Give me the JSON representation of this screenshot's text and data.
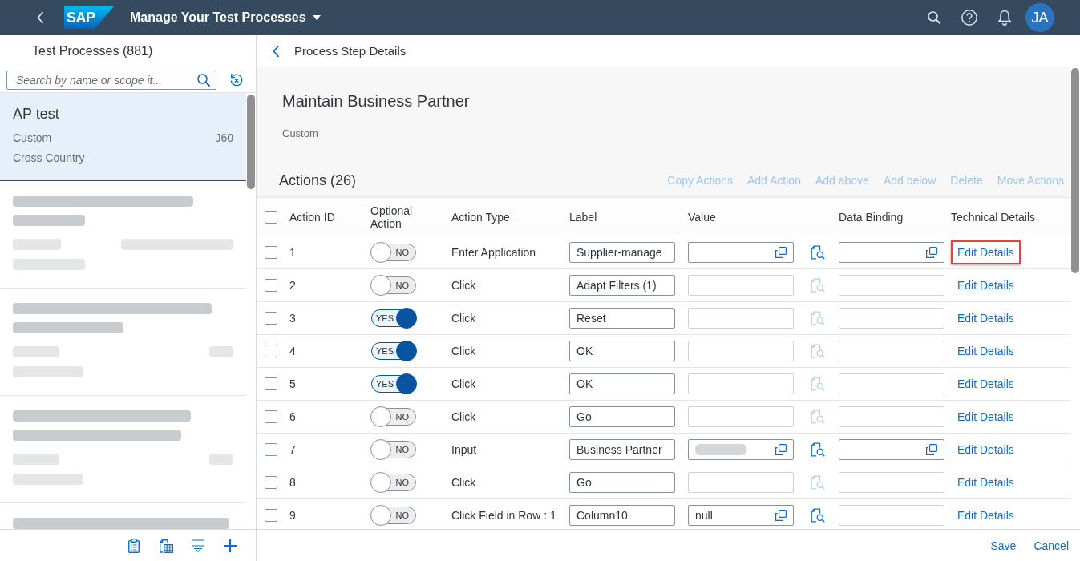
{
  "shell": {
    "logo": "SAP",
    "title": "Manage Your Test Processes",
    "avatar": "JA"
  },
  "master": {
    "title": "Test Processes (881)",
    "search": {
      "placeholder": "Search by name or scope it..."
    },
    "items": [
      {
        "kind": "process",
        "selected": true,
        "title": "AP test",
        "type": "Custom",
        "system": "J60",
        "scope": "Cross Country"
      },
      {
        "kind": "blurred",
        "selected": false
      },
      {
        "kind": "blurred",
        "selected": false
      },
      {
        "kind": "blurred",
        "selected": false
      },
      {
        "kind": "blurred",
        "selected": false
      }
    ]
  },
  "detail": {
    "nav_title": "Process Step Details",
    "title": "Maintain Business Partner",
    "subtitle": "Custom",
    "actions_title": "Actions (26)",
    "toolbar": [
      {
        "label": "Copy Actions",
        "disabled": true
      },
      {
        "label": "Add Action",
        "disabled": true
      },
      {
        "label": "Add above",
        "disabled": true
      },
      {
        "label": "Add below",
        "disabled": true
      },
      {
        "label": "Delete",
        "disabled": true
      },
      {
        "label": "Move Actions",
        "disabled": true
      }
    ],
    "table": {
      "select_all": {
        "checked": false
      },
      "columns": [
        "Action ID",
        "Optional Action",
        "Action Type",
        "Label",
        "Value",
        "Data Binding",
        "Technical Details"
      ],
      "rows": [
        {
          "selected": false,
          "action_id": "1",
          "optional": {
            "on": false,
            "text": "NO"
          },
          "action_type": "Enter Application",
          "label": "Supplier-manage",
          "value": {
            "enabled": true,
            "redacted": false
          },
          "data_binding": {
            "enabled": true
          },
          "details": {
            "text": "Edit Details",
            "highlighted": true
          }
        },
        {
          "selected": false,
          "action_id": "2",
          "optional": {
            "on": false,
            "text": "NO"
          },
          "action_type": "Click",
          "label": "Adapt Filters (1)",
          "value": {
            "enabled": false,
            "redacted": false
          },
          "data_binding": {
            "enabled": false
          },
          "details": {
            "text": "Edit Details",
            "highlighted": false
          }
        },
        {
          "selected": false,
          "action_id": "3",
          "optional": {
            "on": true,
            "text": "YES"
          },
          "action_type": "Click",
          "label": "Reset",
          "value": {
            "enabled": false,
            "redacted": false
          },
          "data_binding": {
            "enabled": false
          },
          "details": {
            "text": "Edit Details",
            "highlighted": false
          }
        },
        {
          "selected": false,
          "action_id": "4",
          "optional": {
            "on": true,
            "text": "YES"
          },
          "action_type": "Click",
          "label": "OK",
          "value": {
            "enabled": false,
            "redacted": false
          },
          "data_binding": {
            "enabled": false
          },
          "details": {
            "text": "Edit Details",
            "highlighted": false
          }
        },
        {
          "selected": false,
          "action_id": "5",
          "optional": {
            "on": true,
            "text": "YES"
          },
          "action_type": "Click",
          "label": "OK",
          "value": {
            "enabled": false,
            "redacted": false
          },
          "data_binding": {
            "enabled": false
          },
          "details": {
            "text": "Edit Details",
            "highlighted": false
          }
        },
        {
          "selected": false,
          "action_id": "6",
          "optional": {
            "on": false,
            "text": "NO"
          },
          "action_type": "Click",
          "label": "Go",
          "value": {
            "enabled": false,
            "redacted": false
          },
          "data_binding": {
            "enabled": false
          },
          "details": {
            "text": "Edit Details",
            "highlighted": false
          }
        },
        {
          "selected": false,
          "action_id": "7",
          "optional": {
            "on": false,
            "text": "NO"
          },
          "action_type": "Input",
          "label": "Business Partner",
          "value": {
            "enabled": true,
            "redacted": true
          },
          "data_binding": {
            "enabled": true
          },
          "details": {
            "text": "Edit Details",
            "highlighted": false
          }
        },
        {
          "selected": false,
          "action_id": "8",
          "optional": {
            "on": false,
            "text": "NO"
          },
          "action_type": "Click",
          "label": "Go",
          "value": {
            "enabled": false,
            "redacted": false
          },
          "data_binding": {
            "enabled": false
          },
          "details": {
            "text": "Edit Details",
            "highlighted": false
          }
        },
        {
          "selected": false,
          "action_id": "9",
          "optional": {
            "on": false,
            "text": "NO"
          },
          "action_type": "Click Field in Row : 1",
          "label": "Column10",
          "value": {
            "enabled": true,
            "redacted": false,
            "text": "null"
          },
          "data_binding": {
            "enabled": false
          },
          "details": {
            "text": "Edit Details",
            "highlighted": false
          }
        }
      ]
    }
  },
  "footer": {
    "buttons": [
      "Save",
      "Cancel"
    ]
  }
}
